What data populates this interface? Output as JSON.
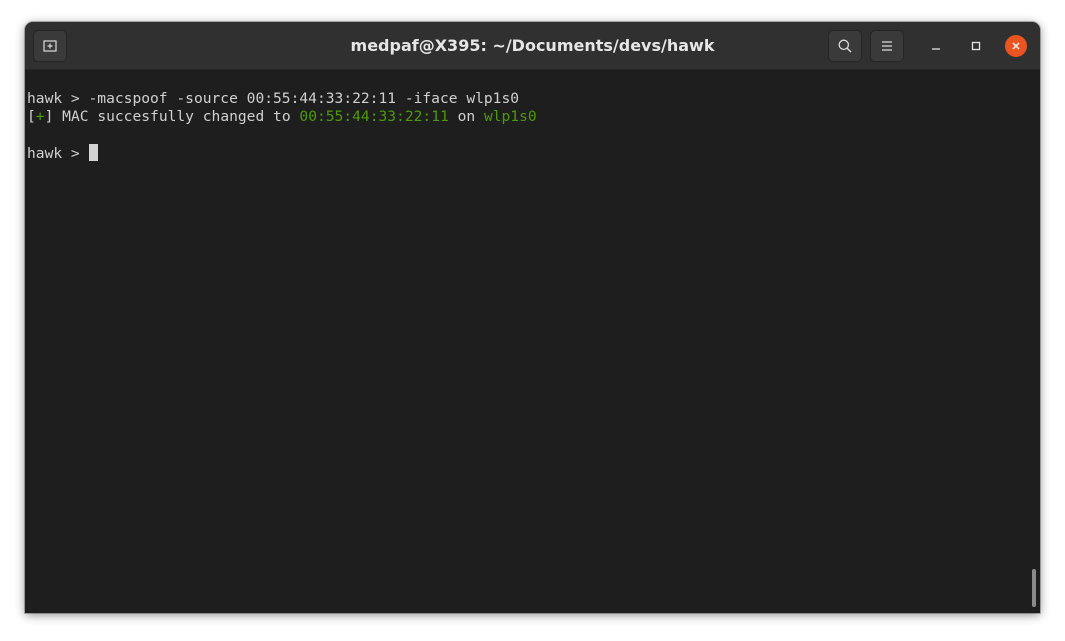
{
  "window": {
    "title": "medpaf@X395: ~/Documents/devs/hawk"
  },
  "titlebar": {
    "new_tab_icon": "new-tab-icon",
    "search_icon": "search-icon",
    "menu_icon": "hamburger-menu-icon",
    "minimize_icon": "minimize-icon",
    "maximize_icon": "maximize-icon",
    "close_icon": "close-icon"
  },
  "terminal": {
    "prompt": "hawk > ",
    "command": "-macspoof -source 00:55:44:33:22:11 -iface wlp1s0",
    "output": {
      "bracket_open": "[",
      "plus": "+",
      "bracket_close": "] ",
      "message": "MAC succesfully changed to ",
      "mac": "00:55:44:33:22:11",
      "on": " on ",
      "iface": "wlp1s0"
    },
    "prompt2": "hawk > "
  },
  "colors": {
    "accent_green": "#4e9a06",
    "close_orange": "#e95420",
    "background": "#1e1e1e",
    "titlebar": "#303030"
  }
}
